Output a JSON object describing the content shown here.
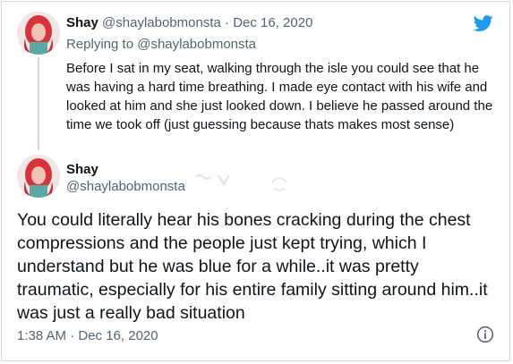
{
  "reply_tweet": {
    "display_name": "Shay",
    "handle": "@shaylabobmonsta",
    "separator": "·",
    "date": "Dec 16, 2020",
    "replying_prefix": "Replying to",
    "replying_to": "@shaylabobmonsta",
    "text": "Before I sat in my seat, walking through the isle you could see that he was having a hard time breathing. I made eye contact with his wife and looked at him and she just looked down. I believe he passed around the time we took off (just guessing because thats makes most sense)"
  },
  "main_tweet": {
    "display_name": "Shay",
    "handle": "@shaylabobmonsta",
    "text": "You could literally hear his bones cracking during the chest compressions and the people just kept trying, which I understand but he was blue for a while..it was pretty traumatic, especially for his entire family sitting around him..it was just a really bad situation",
    "timestamp": "1:38 AM · Dec 16, 2020"
  },
  "icons": {
    "brand": "twitter-bird-icon",
    "info": "info-icon"
  },
  "colors": {
    "twitter_blue": "#1d9bf0",
    "secondary_text": "#536471",
    "primary_text": "#0f1419",
    "border": "#cfd9de"
  }
}
